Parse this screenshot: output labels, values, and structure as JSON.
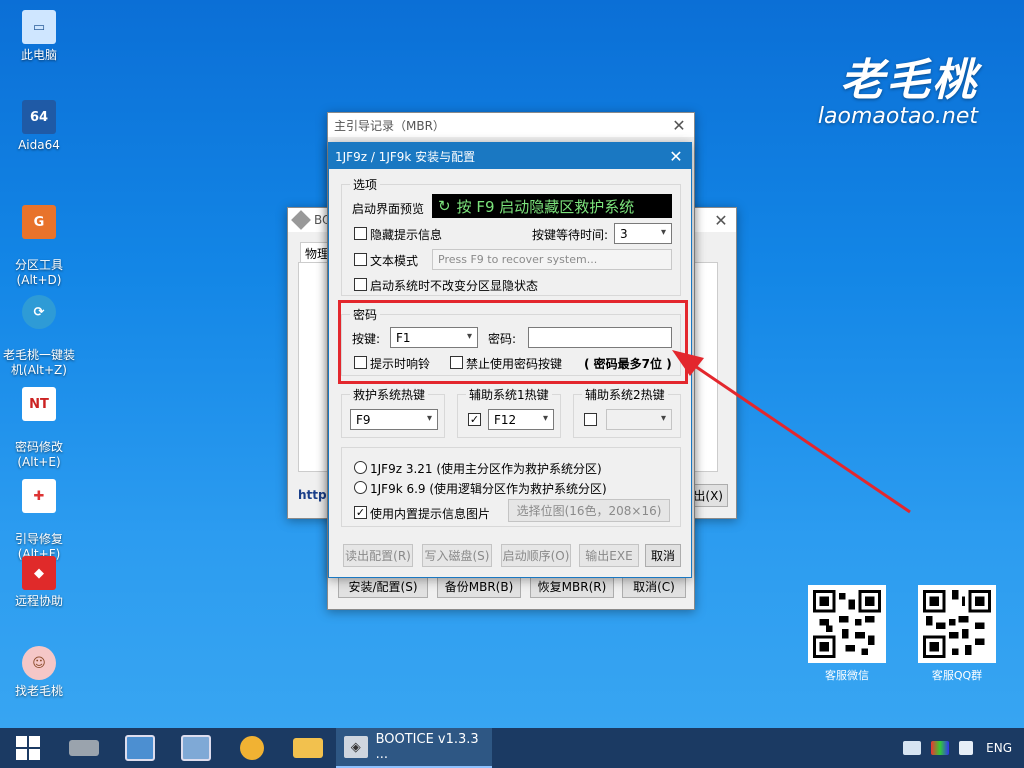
{
  "desktop": {
    "icons": [
      {
        "label": "此电脑",
        "glyph": "▭",
        "color": "#cfe6ff"
      },
      {
        "label": "Aida64",
        "glyph": "64",
        "color": "#1f5aa6"
      },
      {
        "label": "分区工具\n(Alt+D)",
        "glyph": "G",
        "color": "#e8732b"
      },
      {
        "label": "老毛桃一键装\n机(Alt+Z)",
        "glyph": "⟳",
        "color": "#2e9bd6"
      },
      {
        "label": "密码修改\n(Alt+E)",
        "glyph": "NT",
        "color": "#ffffff"
      },
      {
        "label": "引导修复\n(Alt+F)",
        "glyph": "✚",
        "color": "#ffffff"
      },
      {
        "label": "远程协助",
        "glyph": "◆",
        "color": "#e02a2a"
      },
      {
        "label": "找老毛桃",
        "glyph": "☺",
        "color": "#f5c7c7"
      }
    ],
    "logo_cn": "老毛桃",
    "logo_en": "laomaotao.net",
    "qr_left_label": "客服微信",
    "qr_right_label": "客服QQ群"
  },
  "bg_window": {
    "title": "BOO",
    "tab_label": "物理",
    "http_text": "http:",
    "exit_fragment": "出(X)"
  },
  "mbr_window": {
    "title": "主引导记录（MBR）",
    "buttons": {
      "install": "安装/配置(S)",
      "backup": "备份MBR(B)",
      "restore": "恢复MBR(R)",
      "cancel": "取消(C)"
    }
  },
  "config_dialog": {
    "title": "1JF9z / 1JF9k 安装与配置",
    "options": {
      "group_title": "选项",
      "preview_label": "启动界面预览",
      "preview_text": "按 F9 启动隐藏区救护系统",
      "hide_prompt": "隐藏提示信息",
      "wait_time_label": "按键等待时间:",
      "wait_time_value": "3",
      "text_mode": "文本模式",
      "text_mode_placeholder": "Press F9 to recover system...",
      "keep_hidden": "启动系统时不改变分区显隐状态"
    },
    "password": {
      "group_title": "密码",
      "key_label": "按键:",
      "key_value": "F1",
      "pwd_label": "密码:",
      "pwd_value": "",
      "beep": "提示时响铃",
      "disable_key": "禁止使用密码按键",
      "max_hint": "( 密码最多7位 )"
    },
    "hotkeys": {
      "rescue_title": "救护系统热键",
      "rescue_value": "F9",
      "aux1_title": "辅助系统1热键",
      "aux1_checked": "✓",
      "aux1_value": "F12",
      "aux2_title": "辅助系统2热键",
      "aux2_value": ""
    },
    "modes": {
      "radio1": "1JF9z 3.21 (使用主分区作为救护系统分区)",
      "radio2": "1JF9k 6.9 (使用逻辑分区作为救护系统分区)",
      "builtin_image": "使用内置提示信息图片",
      "builtin_checked": "✓",
      "select_bitmap": "选择位图(16色，208×16)"
    },
    "buttons": {
      "read_config": "读出配置(R)",
      "write_disk": "写入磁盘(S)",
      "boot_order": "启动顺序(O)",
      "export_exe": "输出EXE",
      "cancel": "取消"
    }
  },
  "taskbar": {
    "app_label": "BOOTICE v1.3.3 ...",
    "lang": "ENG"
  }
}
